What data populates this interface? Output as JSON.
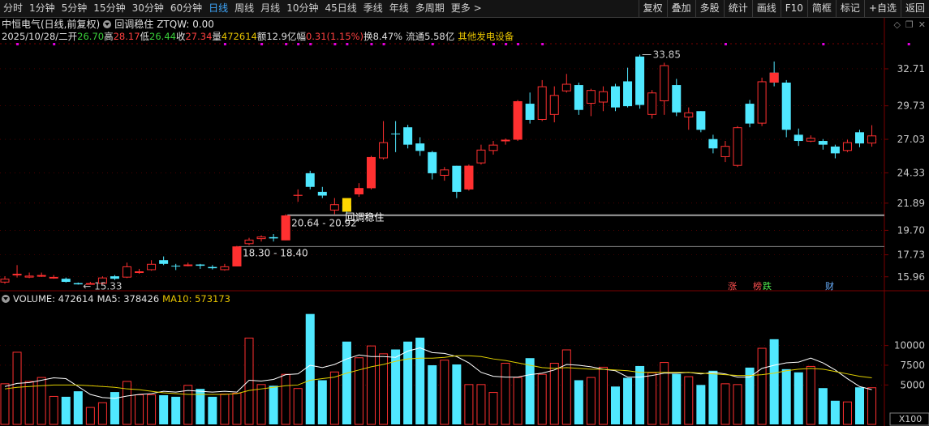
{
  "toolbar": {
    "periods": [
      "分时",
      "1分钟",
      "5分钟",
      "15分钟",
      "30分钟",
      "60分钟",
      "日线",
      "周线",
      "月线",
      "10分钟",
      "45日线",
      "季线",
      "年线",
      "多周期",
      "更多 >"
    ],
    "active_period": "日线",
    "buttons": [
      "复权",
      "叠加",
      "多股",
      "统计",
      "画线",
      "F10",
      "简框",
      "标记",
      "+自选",
      "返回"
    ]
  },
  "header": {
    "stock_title": "中恒电气(日线,前复权)",
    "indicator_name": "回调稳住",
    "indicator_value": "ZTQW: 0.00",
    "date": "2025/10/28/二",
    "open_label": "开",
    "open": "26.70",
    "high_label": "高",
    "high": "28.17",
    "low_label": "低",
    "low": "26.44",
    "close_label": "收",
    "close": "27.34",
    "volume_label": "量",
    "volume": "472614",
    "amount_label": "额",
    "amount": "12.9亿",
    "change_label": "幅",
    "change": "0.31(1.15%)",
    "turnover_label": "换",
    "turnover": "8.47%",
    "float_label": "流通",
    "float": "5.58亿",
    "sector": "其他发电设备"
  },
  "volume_header": {
    "volume": "VOLUME: 472614",
    "ma5": "MA5: 378426",
    "ma10": "MA10: 573173"
  },
  "badges": {
    "rise": "涨",
    "rank": "榜",
    "fall": "跌",
    "finance": "财"
  },
  "colors": {
    "up": "#ff3030",
    "down": "#50e8ff",
    "ma5": "#ffffff",
    "ma10": "#e0d000",
    "grid": "#7a0000",
    "text_axis": "#c8c8c8",
    "signal": "#ffd700",
    "level_line": "#a0a0a0",
    "mark_dot": "#e000e0"
  },
  "chart_data": {
    "type": "candlestick",
    "price_axis": {
      "ticks": [
        32.71,
        29.73,
        27.03,
        24.33,
        21.89,
        19.7,
        17.73,
        15.96
      ]
    },
    "volume_axis": {
      "ticks": [
        10000,
        7500,
        5000
      ],
      "unit_label": "X100"
    },
    "annotations": {
      "low_marker": "15.33",
      "high_marker": "33.85",
      "zone1": "18.30 - 18.40",
      "zone2": "20.64 - 20.92",
      "signal_label": "回调稳住"
    },
    "candles": [
      {
        "o": 15.5,
        "c": 15.8,
        "h": 16.0,
        "l": 15.4
      },
      {
        "o": 16.1,
        "c": 16.2,
        "h": 16.9,
        "l": 15.9
      },
      {
        "o": 15.9,
        "c": 16.05,
        "h": 16.3,
        "l": 15.85
      },
      {
        "o": 16.0,
        "c": 16.1,
        "h": 16.3,
        "l": 15.95
      },
      {
        "o": 15.85,
        "c": 15.95,
        "h": 16.1,
        "l": 15.8
      },
      {
        "o": 15.8,
        "c": 15.55,
        "h": 15.9,
        "l": 15.5
      },
      {
        "o": 15.45,
        "c": 15.35,
        "h": 15.5,
        "l": 15.33
      },
      {
        "o": 15.35,
        "c": 15.45,
        "h": 15.55,
        "l": 15.33
      },
      {
        "o": 15.4,
        "c": 15.9,
        "h": 16.0,
        "l": 15.35
      },
      {
        "o": 16.0,
        "c": 15.8,
        "h": 16.1,
        "l": 15.7
      },
      {
        "o": 15.9,
        "c": 16.8,
        "h": 17.1,
        "l": 15.85
      },
      {
        "o": 16.3,
        "c": 16.4,
        "h": 16.6,
        "l": 16.2
      },
      {
        "o": 16.5,
        "c": 17.0,
        "h": 17.3,
        "l": 16.45
      },
      {
        "o": 17.3,
        "c": 17.0,
        "h": 17.6,
        "l": 16.9
      },
      {
        "o": 16.85,
        "c": 16.8,
        "h": 17.0,
        "l": 16.5
      },
      {
        "o": 16.9,
        "c": 16.95,
        "h": 17.1,
        "l": 16.8
      },
      {
        "o": 16.95,
        "c": 16.85,
        "h": 17.0,
        "l": 16.6
      },
      {
        "o": 16.75,
        "c": 16.65,
        "h": 16.9,
        "l": 16.55
      },
      {
        "o": 16.5,
        "c": 16.8,
        "h": 17.0,
        "l": 16.45
      },
      {
        "o": 16.8,
        "c": 18.4,
        "h": 18.45,
        "l": 16.8
      },
      {
        "o": 18.6,
        "c": 18.95,
        "h": 19.1,
        "l": 18.5
      },
      {
        "o": 19.0,
        "c": 19.2,
        "h": 19.3,
        "l": 18.8
      },
      {
        "o": 19.15,
        "c": 19.05,
        "h": 19.4,
        "l": 18.8
      },
      {
        "o": 18.9,
        "c": 20.9,
        "h": 21.0,
        "l": 18.9
      },
      {
        "o": 22.5,
        "c": 22.55,
        "h": 23.0,
        "l": 22.0
      },
      {
        "o": 24.3,
        "c": 23.2,
        "h": 24.5,
        "l": 23.0
      },
      {
        "o": 22.8,
        "c": 22.5,
        "h": 23.2,
        "l": 22.3
      },
      {
        "o": 21.3,
        "c": 21.8,
        "h": 22.3,
        "l": 21.0
      },
      {
        "o": 21.7,
        "c": 21.2,
        "h": 21.8,
        "l": 21.1
      },
      {
        "o": 22.6,
        "c": 23.1,
        "h": 23.5,
        "l": 22.4
      },
      {
        "o": 23.1,
        "c": 25.6,
        "h": 25.7,
        "l": 23.0
      },
      {
        "o": 25.5,
        "c": 26.8,
        "h": 28.5,
        "l": 25.4
      },
      {
        "o": 27.5,
        "c": 27.45,
        "h": 28.5,
        "l": 26.0
      },
      {
        "o": 28.0,
        "c": 26.6,
        "h": 28.2,
        "l": 26.3
      },
      {
        "o": 26.7,
        "c": 26.1,
        "h": 27.2,
        "l": 25.7
      },
      {
        "o": 26.0,
        "c": 24.3,
        "h": 26.1,
        "l": 23.8
      },
      {
        "o": 24.1,
        "c": 24.6,
        "h": 24.8,
        "l": 23.7
      },
      {
        "o": 24.9,
        "c": 22.8,
        "h": 24.9,
        "l": 22.3
      },
      {
        "o": 23.0,
        "c": 24.9,
        "h": 25.0,
        "l": 22.9
      },
      {
        "o": 25.1,
        "c": 26.2,
        "h": 26.6,
        "l": 25.0
      },
      {
        "o": 26.1,
        "c": 26.6,
        "h": 26.9,
        "l": 25.8
      },
      {
        "o": 26.9,
        "c": 27.0,
        "h": 27.1,
        "l": 26.6
      },
      {
        "o": 27.0,
        "c": 30.1,
        "h": 30.2,
        "l": 26.9
      },
      {
        "o": 29.9,
        "c": 28.6,
        "h": 30.8,
        "l": 28.3
      },
      {
        "o": 28.6,
        "c": 31.3,
        "h": 31.8,
        "l": 28.5
      },
      {
        "o": 29.0,
        "c": 30.6,
        "h": 31.3,
        "l": 28.4
      },
      {
        "o": 30.9,
        "c": 31.5,
        "h": 32.3,
        "l": 30.8
      },
      {
        "o": 31.4,
        "c": 29.4,
        "h": 31.6,
        "l": 29.0
      },
      {
        "o": 29.9,
        "c": 31.0,
        "h": 31.1,
        "l": 28.9
      },
      {
        "o": 30.0,
        "c": 30.9,
        "h": 31.3,
        "l": 29.3
      },
      {
        "o": 31.3,
        "c": 29.6,
        "h": 31.5,
        "l": 29.3
      },
      {
        "o": 31.7,
        "c": 29.7,
        "h": 32.8,
        "l": 29.6
      },
      {
        "o": 33.7,
        "c": 29.8,
        "h": 33.85,
        "l": 29.5
      },
      {
        "o": 29.0,
        "c": 30.8,
        "h": 31.0,
        "l": 28.7
      },
      {
        "o": 30.1,
        "c": 33.0,
        "h": 33.2,
        "l": 29.0
      },
      {
        "o": 31.4,
        "c": 29.2,
        "h": 31.9,
        "l": 28.9
      },
      {
        "o": 28.8,
        "c": 29.2,
        "h": 29.6,
        "l": 27.8
      },
      {
        "o": 29.3,
        "c": 27.8,
        "h": 29.3,
        "l": 27.6
      },
      {
        "o": 27.05,
        "c": 26.3,
        "h": 27.4,
        "l": 25.9
      },
      {
        "o": 25.6,
        "c": 26.5,
        "h": 26.9,
        "l": 25.2
      },
      {
        "o": 24.9,
        "c": 28.0,
        "h": 28.1,
        "l": 24.8
      },
      {
        "o": 29.9,
        "c": 28.3,
        "h": 30.2,
        "l": 28.0
      },
      {
        "o": 28.3,
        "c": 31.7,
        "h": 32.0,
        "l": 28.1
      },
      {
        "o": 32.4,
        "c": 31.6,
        "h": 33.3,
        "l": 31.3
      },
      {
        "o": 31.6,
        "c": 27.8,
        "h": 31.8,
        "l": 27.2
      },
      {
        "o": 27.4,
        "c": 26.9,
        "h": 27.9,
        "l": 26.5
      },
      {
        "o": 26.85,
        "c": 27.15,
        "h": 27.35,
        "l": 26.8
      },
      {
        "o": 26.9,
        "c": 26.6,
        "h": 27.05,
        "l": 26.2
      },
      {
        "o": 26.45,
        "c": 25.9,
        "h": 26.6,
        "l": 25.5
      },
      {
        "o": 26.1,
        "c": 26.8,
        "h": 27.0,
        "l": 26.0
      },
      {
        "o": 27.6,
        "c": 26.7,
        "h": 27.8,
        "l": 26.4
      },
      {
        "o": 26.7,
        "c": 27.34,
        "h": 28.17,
        "l": 26.44
      }
    ],
    "volume": [
      5200,
      9200,
      5500,
      6000,
      3600,
      3500,
      4200,
      2200,
      2800,
      4100,
      5500,
      3800,
      3800,
      3700,
      3500,
      5000,
      4500,
      3500,
      3900,
      4000,
      11000,
      5100,
      4900,
      6400,
      4600,
      14000,
      5600,
      6700,
      10500,
      8500,
      10000,
      9000,
      9500,
      10500,
      11000,
      7500,
      8200,
      7600,
      5100,
      5100,
      4100,
      7800,
      6000,
      8400,
      6400,
      7800,
      9500,
      5600,
      6000,
      7300,
      4800,
      5900,
      7400,
      6600,
      7900,
      6400,
      6100,
      5000,
      6800,
      5200,
      5100,
      7200,
      9700,
      10800,
      7000,
      6600,
      7400,
      4600,
      3000,
      2900,
      4700,
      4700
    ],
    "ma5": [
      4800,
      5200,
      5300,
      5600,
      5900,
      5800,
      4800,
      3800,
      3400,
      3300,
      3600,
      3800,
      3900,
      4200,
      4100,
      4300,
      4200,
      4100,
      4200,
      4100,
      5600,
      5500,
      5700,
      6300,
      6400,
      7500,
      7200,
      7600,
      8300,
      8800,
      8600,
      8600,
      8500,
      9300,
      9700,
      9100,
      9000,
      8600,
      7800,
      6600,
      6100,
      6000,
      6000,
      6300,
      6500,
      6900,
      7600,
      7500,
      7300,
      7000,
      6800,
      6000,
      6000,
      6200,
      6500,
      6500,
      6600,
      6400,
      6600,
      6400,
      6000,
      6000,
      7100,
      7500,
      7800,
      7900,
      8400,
      7800,
      6900,
      5800,
      4800,
      4400
    ],
    "ma10": [
      4500,
      4700,
      4800,
      4900,
      5000,
      5000,
      5000,
      4900,
      4800,
      4700,
      4500,
      4400,
      4200,
      4000,
      3900,
      3800,
      3800,
      3800,
      3800,
      3900,
      4300,
      4500,
      4700,
      4900,
      5000,
      5600,
      5800,
      6000,
      6500,
      6900,
      7300,
      7600,
      8000,
      8300,
      8400,
      8400,
      8500,
      8700,
      8700,
      8600,
      8300,
      8100,
      7800,
      7500,
      7200,
      7100,
      7200,
      7100,
      7000,
      7000,
      6900,
      6800,
      6600,
      6600,
      6600,
      6600,
      6600,
      6500,
      6400,
      6300,
      6200,
      6200,
      6300,
      6500,
      6800,
      7000,
      7100,
      7000,
      6700,
      6400,
      6100,
      5900
    ]
  }
}
